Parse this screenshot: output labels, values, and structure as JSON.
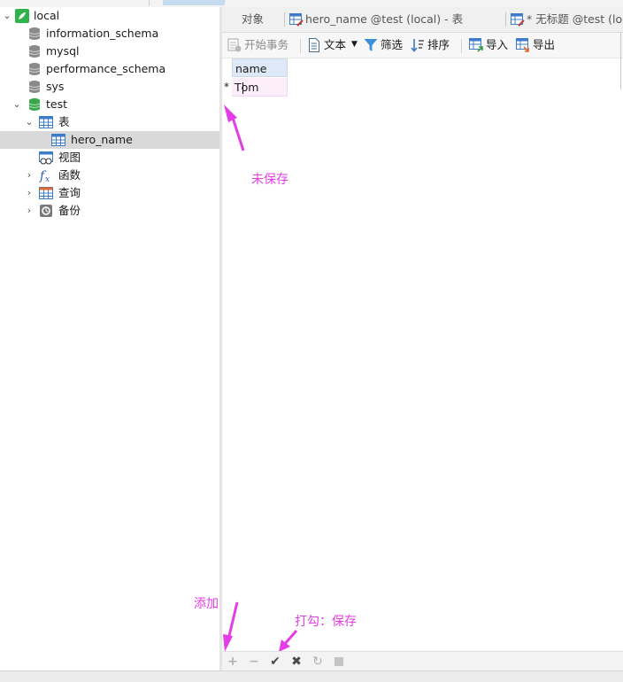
{
  "sidebar": {
    "connection": "local",
    "databases": [
      "information_schema",
      "mysql",
      "performance_schema",
      "sys",
      "test"
    ],
    "groups": {
      "tables": "表",
      "table_item": "hero_name",
      "views": "视图",
      "functions": "函数",
      "queries": "查询",
      "backups": "备份"
    }
  },
  "tabs": {
    "objects": "对象",
    "table_tab": "hero_name @test (local) - 表",
    "untitled_tab": "* 无标题 @test (loc"
  },
  "toolbar": {
    "begin_transaction": "开始事务",
    "text": "文本",
    "filter": "筛选",
    "sort": "排序",
    "import": "导入",
    "export": "导出"
  },
  "grid": {
    "column": "name",
    "row_marker": "*",
    "cell_before_caret": "T",
    "cell_after_caret": "om"
  },
  "annotations": {
    "unsaved": "未保存",
    "add": "添加",
    "check_save": "打勾：保存"
  },
  "icons": [
    "navicat-connection-icon",
    "database-icon",
    "database-open-icon",
    "table-folder-icon",
    "table-icon",
    "view-icon",
    "function-icon",
    "query-icon",
    "backup-icon",
    "add-row-icon",
    "delete-row-icon",
    "apply-icon",
    "discard-icon",
    "refresh-icon",
    "stop-icon"
  ],
  "colors": {
    "annotation": "#e43de6",
    "selected_row": "#d9d9d9",
    "edited_cell": "#fdeefb",
    "header": "#dde9f6",
    "database_open": "#3aa84a"
  }
}
